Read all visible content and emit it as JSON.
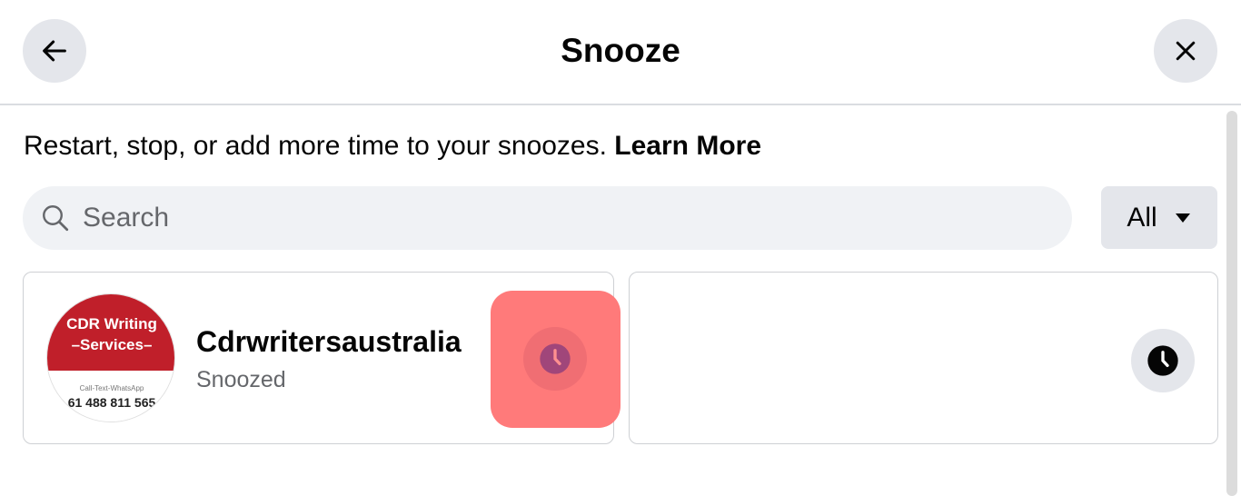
{
  "header": {
    "title": "Snooze"
  },
  "intro": {
    "text": "Restart, stop, or add more time to your snoozes.",
    "learn_more": "Learn More"
  },
  "search": {
    "placeholder": "Search",
    "value": ""
  },
  "filter": {
    "selected": "All"
  },
  "cards": [
    {
      "name": "Cdrwritersaustralia",
      "status": "Snoozed",
      "avatar_text": {
        "line1": "CDR Writing",
        "line2": "–Services–",
        "line3": "Call-Text-WhatsApp",
        "line4": "61 488 811 565"
      }
    },
    {
      "name": "",
      "status": ""
    }
  ],
  "icons": {
    "back": "arrow-left-icon",
    "close": "close-icon",
    "search": "search-icon",
    "dropdown": "caret-down-icon",
    "snooze": "clock-icon"
  },
  "colors": {
    "highlight": "#ff7a7a",
    "button_bg": "#e4e6eb",
    "brand_red": "#c01f2a"
  }
}
